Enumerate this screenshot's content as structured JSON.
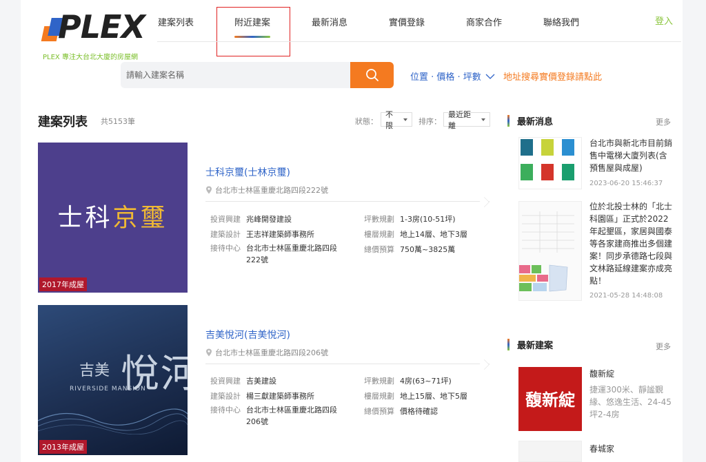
{
  "brand": {
    "logo_text": "PLEX",
    "tagline": "PLEX 專注大台北大廈的房屋網"
  },
  "nav": {
    "items": [
      "建案列表",
      "附近建案",
      "最新消息",
      "實價登錄",
      "商家合作",
      "聯絡我們"
    ],
    "active_index": 1,
    "login": "登入"
  },
  "search": {
    "placeholder": "請輸入建案名稱",
    "filter_label": "位置 · 價格 · 坪數",
    "address_link": "地址搜尋實價登錄請點此"
  },
  "listing": {
    "title": "建案列表",
    "count": "共5153筆",
    "status_label": "狀態：",
    "status_value": "不限",
    "sort_label": "排序：",
    "sort_value": "最近距離"
  },
  "cards": [
    {
      "image_text_white": "士科",
      "image_text_gold": "京璽",
      "year": "2017年成屋",
      "title": "士科京璽(士林京璽)",
      "address": "台北市士林區重慶北路四段222號",
      "fields": [
        {
          "k": "投資興建",
          "v": "兆峰開發建設"
        },
        {
          "k": "建築設計",
          "v": "王志祥建築師事務所"
        },
        {
          "k": "接待中心",
          "v": "台北市士林區重慶北路四段222號"
        },
        {
          "k": "坪數規劃",
          "v": "1-3房(10-51坪)"
        },
        {
          "k": "樓層規劃",
          "v": "地上14層、地下3層"
        },
        {
          "k": "總價預算",
          "v": "750萬~3825萬"
        }
      ]
    },
    {
      "image_text_small": "吉美",
      "image_text_big": "悅河",
      "image_text_en": "RIVERSIDE MANSION",
      "year": "2013年成屋",
      "title": "吉美悅河(吉美悅河)",
      "address": "台北市士林區重慶北路四段206號",
      "fields": [
        {
          "k": "投資興建",
          "v": "吉美建設"
        },
        {
          "k": "建築設計",
          "v": "楊三獻建築師事務所"
        },
        {
          "k": "接待中心",
          "v": "台北市士林區重慶北路四段206號"
        },
        {
          "k": "坪數規劃",
          "v": "4房(63~71坪)"
        },
        {
          "k": "樓層規劃",
          "v": "地上15層、地下5層"
        },
        {
          "k": "總價預算",
          "v": "價格待確認"
        }
      ]
    }
  ],
  "sidebar": {
    "news_title": "最新消息",
    "more": "更多",
    "news": [
      {
        "text": "台北市與新北市目前銷售中電梯大廈列表(含預售屋與成屋)",
        "date": "2023-06-20 15:46:37"
      },
      {
        "text": "位於北投士林的「北士科園區」正式於2022年起墾區，家居與國泰等各家建商推出多個建案！同步承德路七段與文林路延線建案亦成亮點！",
        "date": "2021-05-28 14:48:08"
      }
    ],
    "new_title": "最新建案",
    "new_items": [
      {
        "name": "馥新綻",
        "image_text": "馥新綻",
        "desc": "捷運300米、靜謐覲緣、悠逸生活、24-45坪2-4房"
      },
      {
        "name": "春城家"
      }
    ]
  },
  "colors": {
    "accent_orange": "#f47a20",
    "brand_blue": "#2f64c8",
    "brand_green": "#8cc63f",
    "badge_red": "#b0182c"
  }
}
